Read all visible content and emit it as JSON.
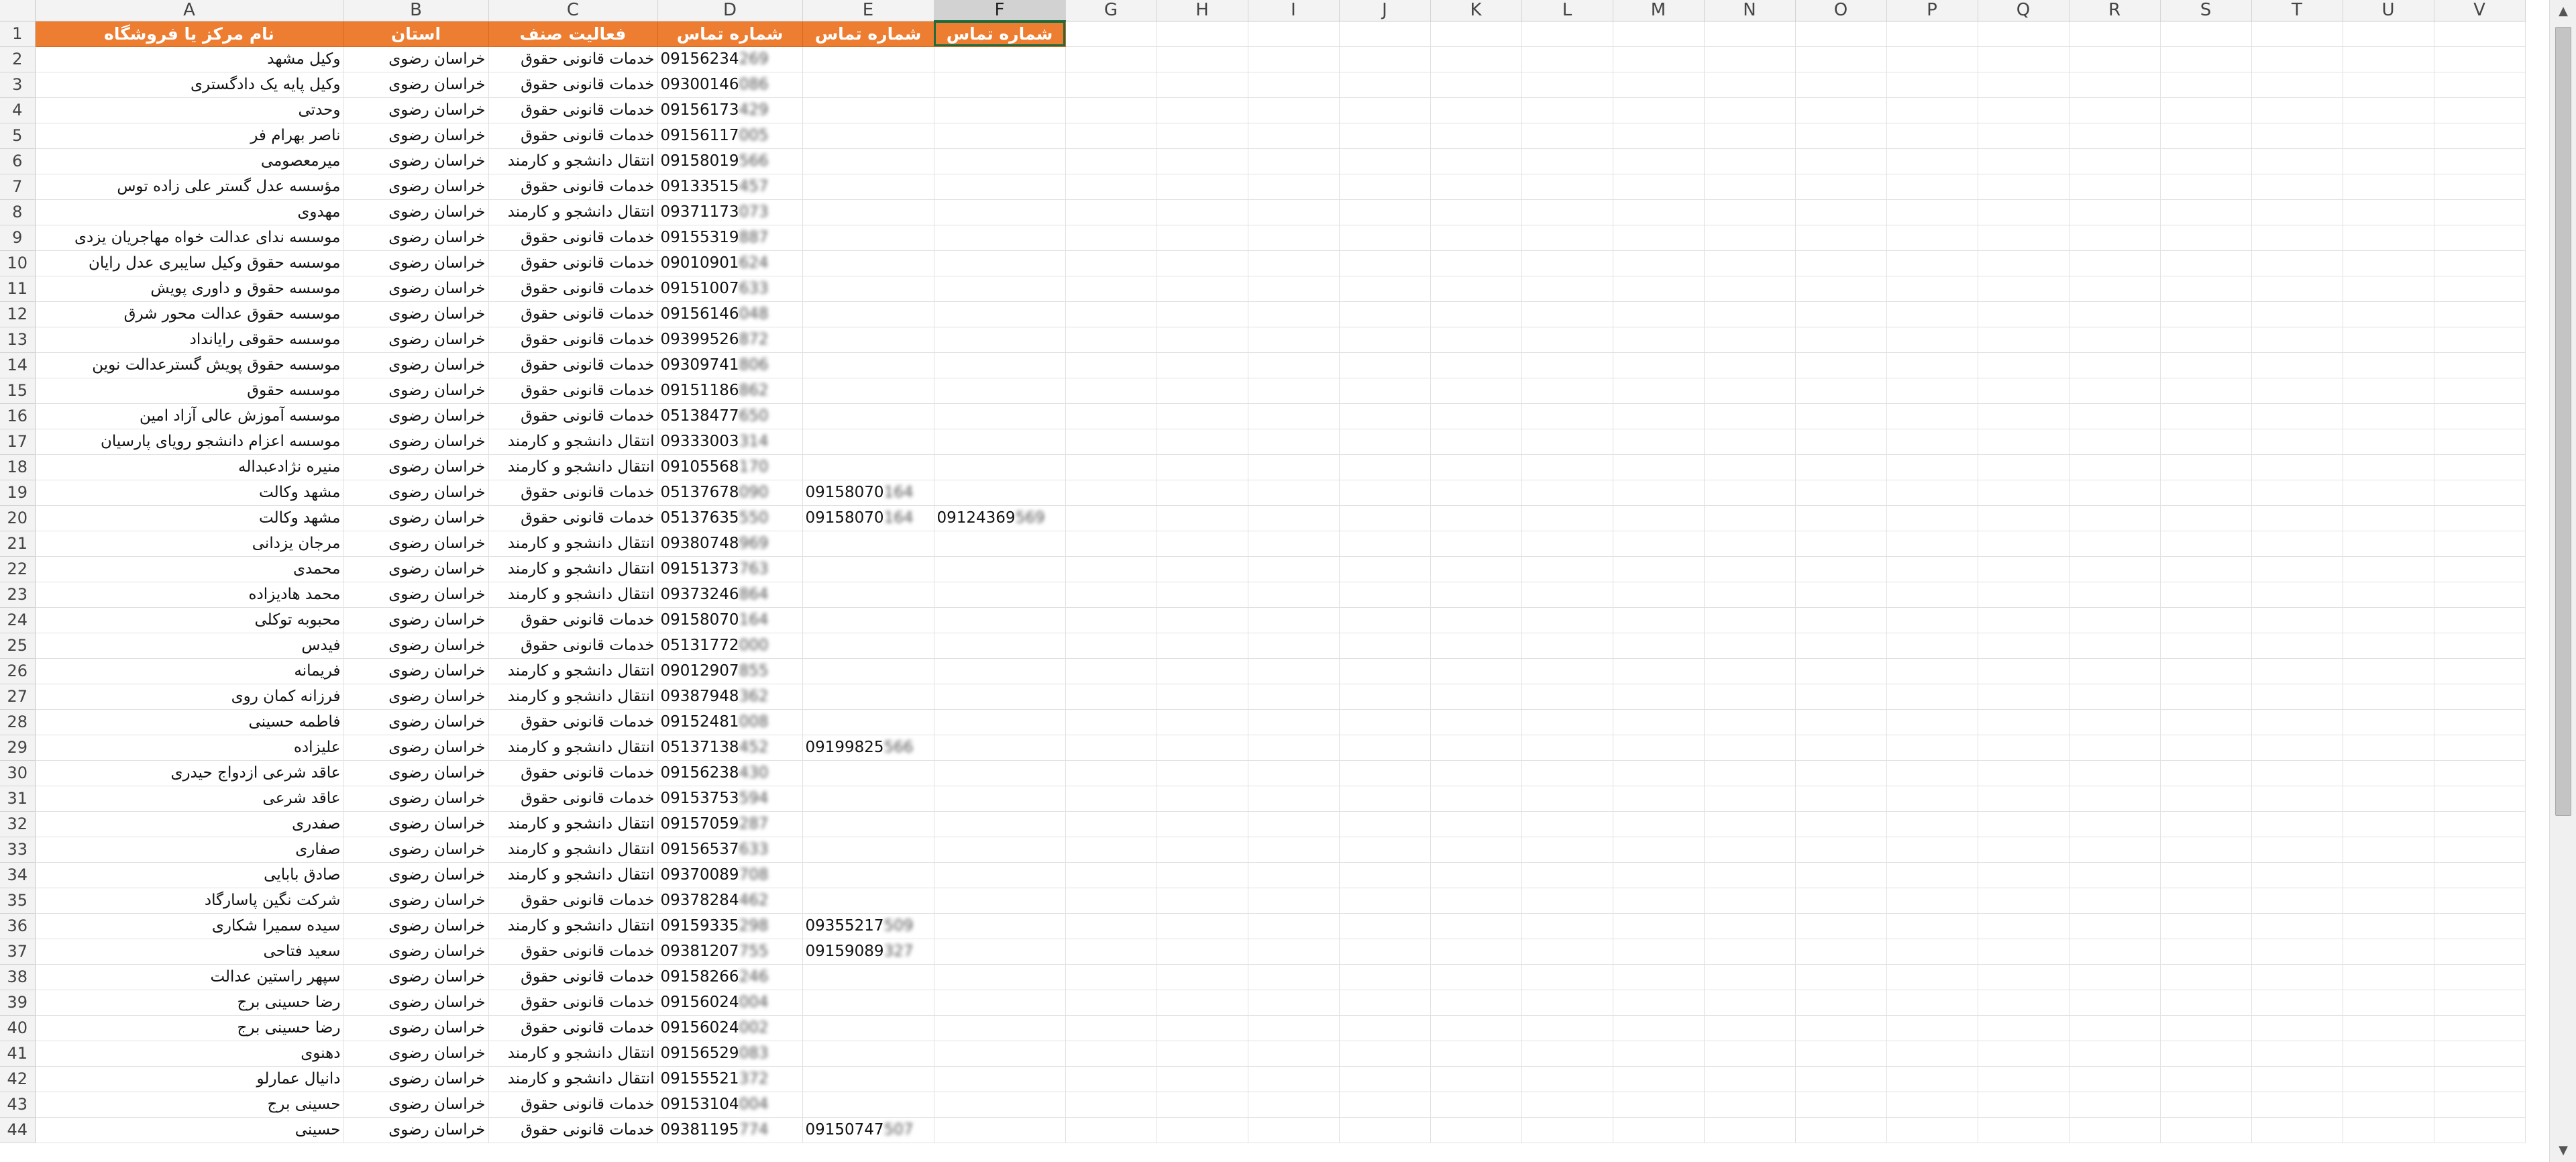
{
  "columns": [
    "A",
    "B",
    "C",
    "D",
    "E",
    "F",
    "G",
    "H",
    "I",
    "J",
    "K",
    "L",
    "M",
    "N",
    "O",
    "P",
    "Q",
    "R",
    "S",
    "T",
    "U",
    "V"
  ],
  "headers": [
    "نام مرکز یا فروشگاه",
    "استان",
    "فعالیت صنف",
    "شماره تماس",
    "شماره تماس",
    "شماره تماس"
  ],
  "rows": [
    {
      "n": 2,
      "name": "وکیل مشهد",
      "prov": "خراسان رضوی",
      "act": "خدمات قانونی حقوق",
      "p1": "09156234",
      "b1": "269",
      "p2": "",
      "b2": "",
      "p3": "",
      "b3": ""
    },
    {
      "n": 3,
      "name": "وکیل پایه یک دادگستری",
      "prov": "خراسان رضوی",
      "act": "خدمات قانونی حقوق",
      "p1": "09300146",
      "b1": "086",
      "p2": "",
      "b2": "",
      "p3": "",
      "b3": ""
    },
    {
      "n": 4,
      "name": "وحدتی",
      "prov": "خراسان رضوی",
      "act": "خدمات قانونی حقوق",
      "p1": "09156173",
      "b1": "429",
      "p2": "",
      "b2": "",
      "p3": "",
      "b3": ""
    },
    {
      "n": 5,
      "name": "ناصر بهرام فر",
      "prov": "خراسان رضوی",
      "act": "خدمات قانونی حقوق",
      "p1": "09156117",
      "b1": "005",
      "p2": "",
      "b2": "",
      "p3": "",
      "b3": ""
    },
    {
      "n": 6,
      "name": "میرمعصومی",
      "prov": "خراسان رضوی",
      "act": "انتقال دانشجو و کارمند",
      "p1": "09158019",
      "b1": "566",
      "p2": "",
      "b2": "",
      "p3": "",
      "b3": ""
    },
    {
      "n": 7,
      "name": "مؤسسه عدل گستر علی زاده توس",
      "prov": "خراسان رضوی",
      "act": "خدمات قانونی حقوق",
      "p1": "09133515",
      "b1": "457",
      "p2": "",
      "b2": "",
      "p3": "",
      "b3": ""
    },
    {
      "n": 8,
      "name": "مهدوی",
      "prov": "خراسان رضوی",
      "act": "انتقال دانشجو و کارمند",
      "p1": "09371173",
      "b1": "073",
      "p2": "",
      "b2": "",
      "p3": "",
      "b3": ""
    },
    {
      "n": 9,
      "name": "موسسه ندای عدالت خواه مهاجریان یزدی",
      "prov": "خراسان رضوی",
      "act": "خدمات قانونی حقوق",
      "p1": "09155319",
      "b1": "887",
      "p2": "",
      "b2": "",
      "p3": "",
      "b3": ""
    },
    {
      "n": 10,
      "name": "موسسه حقوق وکیل سایبری عدل رایان",
      "prov": "خراسان رضوی",
      "act": "خدمات قانونی حقوق",
      "p1": "09010901",
      "b1": "624",
      "p2": "",
      "b2": "",
      "p3": "",
      "b3": ""
    },
    {
      "n": 11,
      "name": "موسسه حقوق و داوری پویش",
      "prov": "خراسان رضوی",
      "act": "خدمات قانونی حقوق",
      "p1": "09151007",
      "b1": "633",
      "p2": "",
      "b2": "",
      "p3": "",
      "b3": ""
    },
    {
      "n": 12,
      "name": "موسسه حقوق عدالت محور شرق",
      "prov": "خراسان رضوی",
      "act": "خدمات قانونی حقوق",
      "p1": "09156146",
      "b1": "048",
      "p2": "",
      "b2": "",
      "p3": "",
      "b3": ""
    },
    {
      "n": 13,
      "name": "موسسه حقوقی رایانداد",
      "prov": "خراسان رضوی",
      "act": "خدمات قانونی حقوق",
      "p1": "09399526",
      "b1": "872",
      "p2": "",
      "b2": "",
      "p3": "",
      "b3": ""
    },
    {
      "n": 14,
      "name": "موسسه حقوق پویش گسترعدالت نوین",
      "prov": "خراسان رضوی",
      "act": "خدمات قانونی حقوق",
      "p1": "09309741",
      "b1": "806",
      "p2": "",
      "b2": "",
      "p3": "",
      "b3": ""
    },
    {
      "n": 15,
      "name": "موسسه حقوق",
      "prov": "خراسان رضوی",
      "act": "خدمات قانونی حقوق",
      "p1": "09151186",
      "b1": "862",
      "p2": "",
      "b2": "",
      "p3": "",
      "b3": ""
    },
    {
      "n": 16,
      "name": "موسسه آموزش عالی آزاد امین",
      "prov": "خراسان رضوی",
      "act": "خدمات قانونی حقوق",
      "p1": "05138477",
      "b1": "650",
      "p2": "",
      "b2": "",
      "p3": "",
      "b3": ""
    },
    {
      "n": 17,
      "name": "موسسه اعزام دانشجو رویای پارسیان",
      "prov": "خراسان رضوی",
      "act": "انتقال دانشجو و کارمند",
      "p1": "09333003",
      "b1": "314",
      "p2": "",
      "b2": "",
      "p3": "",
      "b3": ""
    },
    {
      "n": 18,
      "name": "منیره نژادعبداله",
      "prov": "خراسان رضوی",
      "act": "انتقال دانشجو و کارمند",
      "p1": "09105568",
      "b1": "170",
      "p2": "",
      "b2": "",
      "p3": "",
      "b3": ""
    },
    {
      "n": 19,
      "name": "مشهد وکالت",
      "prov": "خراسان رضوی",
      "act": "خدمات قانونی حقوق",
      "p1": "05137678",
      "b1": "090",
      "p2": "09158070",
      "b2": "164",
      "p3": "",
      "b3": ""
    },
    {
      "n": 20,
      "name": "مشهد وکالت",
      "prov": "خراسان رضوی",
      "act": "خدمات قانونی حقوق",
      "p1": "05137635",
      "b1": "550",
      "p2": "09158070",
      "b2": "164",
      "p3": "09124369",
      "b3": "569"
    },
    {
      "n": 21,
      "name": "مرجان یزدانی",
      "prov": "خراسان رضوی",
      "act": "انتقال دانشجو و کارمند",
      "p1": "09380748",
      "b1": "969",
      "p2": "",
      "b2": "",
      "p3": "",
      "b3": ""
    },
    {
      "n": 22,
      "name": "محمدی",
      "prov": "خراسان رضوی",
      "act": "انتقال دانشجو و کارمند",
      "p1": "09151373",
      "b1": "763",
      "p2": "",
      "b2": "",
      "p3": "",
      "b3": ""
    },
    {
      "n": 23,
      "name": "محمد هادیزاده",
      "prov": "خراسان رضوی",
      "act": "انتقال دانشجو و کارمند",
      "p1": "09373246",
      "b1": "864",
      "p2": "",
      "b2": "",
      "p3": "",
      "b3": ""
    },
    {
      "n": 24,
      "name": "محبوبه توکلی",
      "prov": "خراسان رضوی",
      "act": "خدمات قانونی حقوق",
      "p1": "09158070",
      "b1": "164",
      "p2": "",
      "b2": "",
      "p3": "",
      "b3": ""
    },
    {
      "n": 25,
      "name": "فیدس",
      "prov": "خراسان رضوی",
      "act": "خدمات قانونی حقوق",
      "p1": "05131772",
      "b1": "000",
      "p2": "",
      "b2": "",
      "p3": "",
      "b3": ""
    },
    {
      "n": 26,
      "name": "فریمانه",
      "prov": "خراسان رضوی",
      "act": "انتقال دانشجو و کارمند",
      "p1": "09012907",
      "b1": "855",
      "p2": "",
      "b2": "",
      "p3": "",
      "b3": ""
    },
    {
      "n": 27,
      "name": "فرزانه کمان روی",
      "prov": "خراسان رضوی",
      "act": "انتقال دانشجو و کارمند",
      "p1": "09387948",
      "b1": "362",
      "p2": "",
      "b2": "",
      "p3": "",
      "b3": ""
    },
    {
      "n": 28,
      "name": "فاطمه حسینی",
      "prov": "خراسان رضوی",
      "act": "خدمات قانونی حقوق",
      "p1": "09152481",
      "b1": "008",
      "p2": "",
      "b2": "",
      "p3": "",
      "b3": ""
    },
    {
      "n": 29,
      "name": "علیزاده",
      "prov": "خراسان رضوی",
      "act": "انتقال دانشجو و کارمند",
      "p1": "05137138",
      "b1": "452",
      "p2": "09199825",
      "b2": "566",
      "p3": "",
      "b3": ""
    },
    {
      "n": 30,
      "name": "عاقد شرعی ازدواج حیدری",
      "prov": "خراسان رضوی",
      "act": "خدمات قانونی حقوق",
      "p1": "09156238",
      "b1": "430",
      "p2": "",
      "b2": "",
      "p3": "",
      "b3": ""
    },
    {
      "n": 31,
      "name": "عاقد شرعی",
      "prov": "خراسان رضوی",
      "act": "خدمات قانونی حقوق",
      "p1": "09153753",
      "b1": "594",
      "p2": "",
      "b2": "",
      "p3": "",
      "b3": ""
    },
    {
      "n": 32,
      "name": "صفدری",
      "prov": "خراسان رضوی",
      "act": "انتقال دانشجو و کارمند",
      "p1": "09157059",
      "b1": "287",
      "p2": "",
      "b2": "",
      "p3": "",
      "b3": ""
    },
    {
      "n": 33,
      "name": "صفاری",
      "prov": "خراسان رضوی",
      "act": "انتقال دانشجو و کارمند",
      "p1": "09156537",
      "b1": "633",
      "p2": "",
      "b2": "",
      "p3": "",
      "b3": ""
    },
    {
      "n": 34,
      "name": "صادق بابایی",
      "prov": "خراسان رضوی",
      "act": "انتقال دانشجو و کارمند",
      "p1": "09370089",
      "b1": "708",
      "p2": "",
      "b2": "",
      "p3": "",
      "b3": ""
    },
    {
      "n": 35,
      "name": "شرکت نگین پاسارگاد",
      "prov": "خراسان رضوی",
      "act": "خدمات قانونی حقوق",
      "p1": "09378284",
      "b1": "462",
      "p2": "",
      "b2": "",
      "p3": "",
      "b3": ""
    },
    {
      "n": 36,
      "name": "سیده سمیرا شکاری",
      "prov": "خراسان رضوی",
      "act": "انتقال دانشجو و کارمند",
      "p1": "09159335",
      "b1": "298",
      "p2": "09355217",
      "b2": "509",
      "p3": "",
      "b3": ""
    },
    {
      "n": 37,
      "name": "سعید فتاحی",
      "prov": "خراسان رضوی",
      "act": "خدمات قانونی حقوق",
      "p1": "09381207",
      "b1": "755",
      "p2": "09159089",
      "b2": "327",
      "p3": "",
      "b3": ""
    },
    {
      "n": 38,
      "name": "سپهر راستین عدالت",
      "prov": "خراسان رضوی",
      "act": "خدمات قانونی حقوق",
      "p1": "09158266",
      "b1": "246",
      "p2": "",
      "b2": "",
      "p3": "",
      "b3": ""
    },
    {
      "n": 39,
      "name": "رضا حسینی برج",
      "prov": "خراسان رضوی",
      "act": "خدمات قانونی حقوق",
      "p1": "09156024",
      "b1": "004",
      "p2": "",
      "b2": "",
      "p3": "",
      "b3": ""
    },
    {
      "n": 40,
      "name": "رضا حسینی برج",
      "prov": "خراسان رضوی",
      "act": "خدمات قانونی حقوق",
      "p1": "09156024",
      "b1": "002",
      "p2": "",
      "b2": "",
      "p3": "",
      "b3": ""
    },
    {
      "n": 41,
      "name": "دهنوی",
      "prov": "خراسان رضوی",
      "act": "انتقال دانشجو و کارمند",
      "p1": "09156529",
      "b1": "083",
      "p2": "",
      "b2": "",
      "p3": "",
      "b3": ""
    },
    {
      "n": 42,
      "name": "دانیال عمارلو",
      "prov": "خراسان رضوی",
      "act": "انتقال دانشجو و کارمند",
      "p1": "09155521",
      "b1": "372",
      "p2": "",
      "b2": "",
      "p3": "",
      "b3": ""
    },
    {
      "n": 43,
      "name": "حسینی برج",
      "prov": "خراسان رضوی",
      "act": "خدمات قانونی حقوق",
      "p1": "09153104",
      "b1": "004",
      "p2": "",
      "b2": "",
      "p3": "",
      "b3": ""
    },
    {
      "n": 44,
      "name": "حسینی",
      "prov": "خراسان رضوی",
      "act": "خدمات قانونی حقوق",
      "p1": "09381195",
      "b1": "774",
      "p2": "09150747",
      "b2": "507",
      "p3": "",
      "b3": ""
    }
  ],
  "icons": {
    "scroll_up": "chevron-up-icon",
    "scroll_down": "chevron-down-icon"
  }
}
